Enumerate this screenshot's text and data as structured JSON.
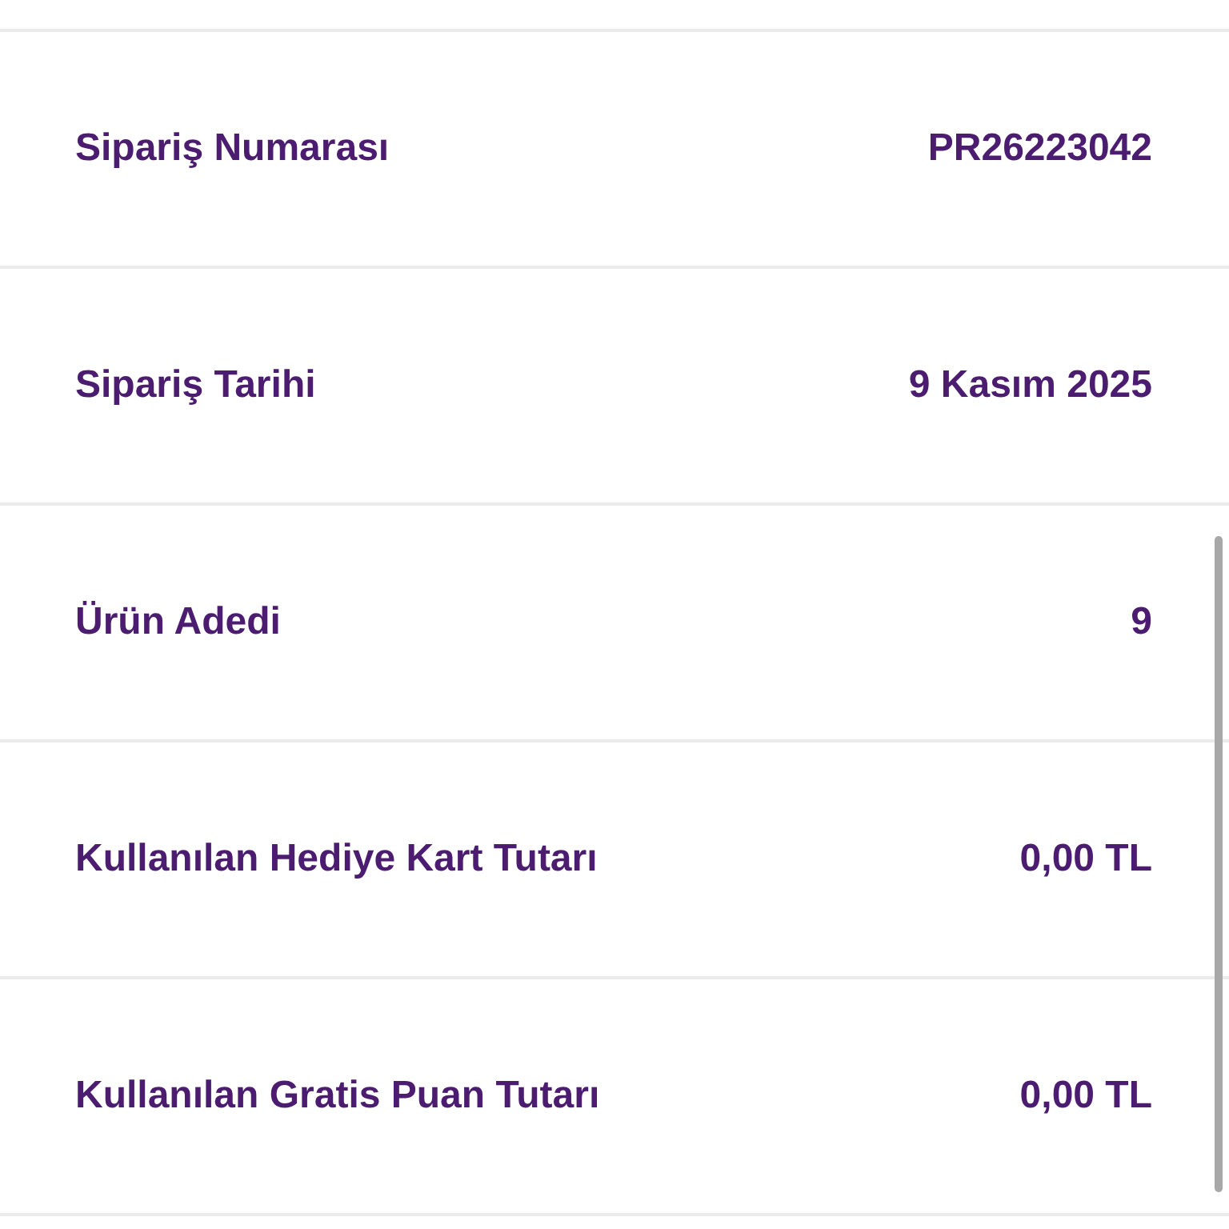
{
  "rows": [
    {
      "label": "Sipariş Numarası",
      "value": "PR26223042"
    },
    {
      "label": "Sipariş Tarihi",
      "value": "9 Kasım 2025"
    },
    {
      "label": "Ürün Adedi",
      "value": "9"
    },
    {
      "label": "Kullanılan Hediye Kart Tutarı",
      "value": "0,00 TL"
    },
    {
      "label": "Kullanılan Gratis Puan Tutarı",
      "value": "0,00 TL"
    }
  ]
}
